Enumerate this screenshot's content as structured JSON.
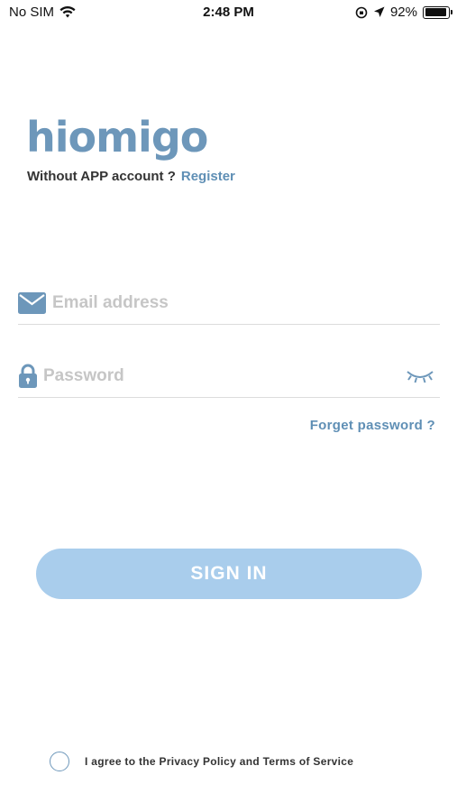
{
  "status_bar": {
    "carrier": "No SIM",
    "time": "2:48 PM",
    "battery": "92%",
    "battery_level": 0.92
  },
  "brand": {
    "logo_text": "hiomigo",
    "logo_color": "#6d97ba"
  },
  "register": {
    "prompt": "Without APP account ?",
    "link_label": "Register"
  },
  "form": {
    "email_placeholder": "Email address",
    "email_icon": "mail-icon",
    "password_placeholder": "Password",
    "password_icon": "lock-icon",
    "visibility_icon": "eye-closed-icon",
    "forget_label": "Forget password ?"
  },
  "actions": {
    "sign_in_label": "SIGN IN",
    "button_color": "#a9cdec"
  },
  "agreement": {
    "text": "I agree to the Privacy Policy and Terms of Service",
    "checked": false
  }
}
